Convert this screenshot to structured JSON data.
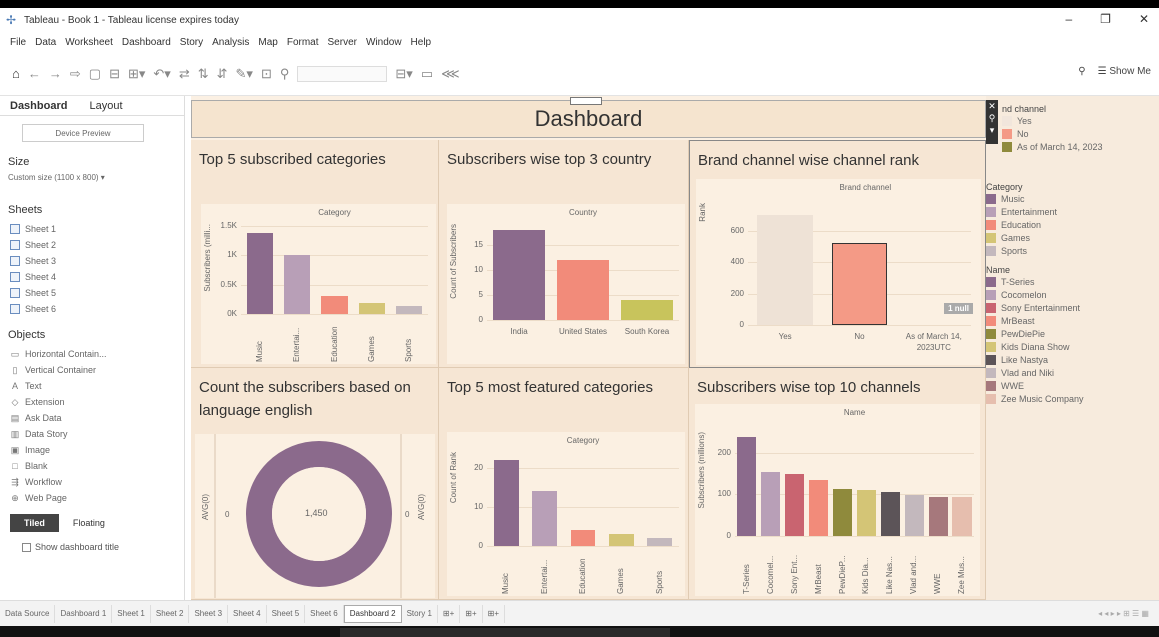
{
  "window": {
    "title": "Tableau - Book 1 - Tableau license expires today",
    "minimize": "–",
    "restore": "❐",
    "close": "✕"
  },
  "menu": [
    "File",
    "Data",
    "Worksheet",
    "Dashboard",
    "Story",
    "Analysis",
    "Map",
    "Format",
    "Server",
    "Window",
    "Help"
  ],
  "toolbar": {
    "show_me": "Show Me"
  },
  "left_pane": {
    "tabs": [
      "Dashboard",
      "Layout"
    ],
    "device_preview": "Device Preview",
    "size_heading": "Size",
    "size_value": "Custom size (1100 x 800) ▾",
    "sheets_heading": "Sheets",
    "sheets": [
      "Sheet 1",
      "Sheet 2",
      "Sheet 3",
      "Sheet 4",
      "Sheet 5",
      "Sheet 6"
    ],
    "objects_heading": "Objects",
    "objects": [
      {
        "icon": "▭",
        "label": "Horizontal Contain..."
      },
      {
        "icon": "▯",
        "label": "Vertical Container"
      },
      {
        "icon": "A",
        "label": "Text"
      },
      {
        "icon": "◇",
        "label": "Extension"
      },
      {
        "icon": "▤",
        "label": "Ask Data"
      },
      {
        "icon": "▥",
        "label": "Data Story"
      },
      {
        "icon": "▣",
        "label": "Image"
      },
      {
        "icon": "□",
        "label": "Blank"
      },
      {
        "icon": "⇶",
        "label": "Workflow"
      },
      {
        "icon": "⊕",
        "label": "Web Page"
      }
    ],
    "tiled": "Tiled",
    "floating": "Floating",
    "show_title": "Show dashboard title"
  },
  "dashboard": {
    "title": "Dashboard",
    "panels": {
      "p1": {
        "title": "Top  5  subscribed categories"
      },
      "p2": {
        "title": "Subscribers wise top 3 country"
      },
      "p3": {
        "title": "Brand channel wise channel rank"
      },
      "p4": {
        "title": "Count the subscribers based on language english"
      },
      "p5": {
        "title": "Top 5 most featured categories"
      },
      "p6": {
        "title": "Subscribers wise top 10 channels"
      }
    }
  },
  "chart_data": [
    {
      "type": "bar",
      "header": "Category",
      "ylabel": "Subscribers (milli...",
      "ylim": [
        0,
        1600
      ],
      "yticks": [
        "0K",
        "0.5K",
        "1K",
        "1.5K"
      ],
      "categories": [
        "Music",
        "Entertai...",
        "Education",
        "Games",
        "Sports"
      ],
      "values": [
        1380,
        1000,
        310,
        190,
        130
      ],
      "colors": [
        "#8b6a8c",
        "#b89fb7",
        "#f28b7a",
        "#d4c576",
        "#c3b8bd"
      ]
    },
    {
      "type": "bar",
      "header": "Country",
      "ylabel": "Count of Subscribers",
      "ylim": [
        0,
        20
      ],
      "yticks": [
        "0",
        "5",
        "10",
        "15"
      ],
      "categories": [
        "India",
        "United States",
        "South Korea"
      ],
      "values": [
        18,
        12,
        4
      ],
      "colors": [
        "#8b6a8c",
        "#f28b7a",
        "#c8c45c"
      ]
    },
    {
      "type": "bar",
      "header": "Brand channel",
      "ylabel": "Rank",
      "ylim": [
        0,
        800
      ],
      "yticks": [
        "0",
        "200",
        "400",
        "600"
      ],
      "categories": [
        "Yes",
        "No",
        "As of March 14, 2023UTC"
      ],
      "values": [
        700,
        520,
        0
      ],
      "colors": [
        "#eee2d6",
        "#f49a86",
        "#d8cdc2"
      ],
      "null_badge": "1 null"
    },
    {
      "type": "pie",
      "header": "",
      "center_label": "1,450",
      "values": [
        1450
      ],
      "colors": [
        "#8b6a8c"
      ],
      "side_labels": [
        "AVG(0)",
        "0",
        "0",
        "AVG(0)"
      ]
    },
    {
      "type": "bar",
      "header": "Category",
      "ylabel": "Count of Rank",
      "ylim": [
        0,
        25
      ],
      "yticks": [
        "0",
        "10",
        "20"
      ],
      "categories": [
        "Music",
        "Entertai...",
        "Education",
        "Games",
        "Sports"
      ],
      "values": [
        22,
        14,
        4,
        3,
        2
      ],
      "colors": [
        "#8b6a8c",
        "#b89fb7",
        "#f28b7a",
        "#d4c576",
        "#c3b8bd"
      ]
    },
    {
      "type": "bar",
      "header": "Name",
      "ylabel": "Subscribers (millions)",
      "ylim": [
        0,
        260
      ],
      "yticks": [
        "0",
        "100",
        "200"
      ],
      "categories": [
        "T-Series",
        "Cocomel...",
        "Sony Ent...",
        "MrBeast",
        "PewDieP...",
        "Kids Dia...",
        "Like Nas...",
        "Vlad and...",
        "WWE",
        "Zee Mus..."
      ],
      "values": [
        238,
        155,
        150,
        135,
        112,
        111,
        106,
        98,
        95,
        94
      ],
      "colors": [
        "#8b6a8c",
        "#b89fb7",
        "#c96470",
        "#f28b7a",
        "#8f8a3c",
        "#d4c576",
        "#5c5458",
        "#c3b8bd",
        "#a6787c",
        "#e6beae"
      ]
    }
  ],
  "legend": {
    "brand_heading": "nd channel",
    "brand": [
      {
        "label": "Yes",
        "color": "#f1e6dc"
      },
      {
        "label": "No",
        "color": "#f49a86"
      },
      {
        "label": "As of March 14, 2023",
        "color": "#8f8a3c"
      }
    ],
    "category_heading": "Category",
    "category": [
      {
        "label": "Music",
        "color": "#8b6a8c"
      },
      {
        "label": "Entertainment",
        "color": "#b89fb7"
      },
      {
        "label": "Education",
        "color": "#f28b7a"
      },
      {
        "label": "Games",
        "color": "#d4c576"
      },
      {
        "label": "Sports",
        "color": "#c3b8bd"
      }
    ],
    "name_heading": "Name",
    "name": [
      {
        "label": "T-Series",
        "color": "#8b6a8c"
      },
      {
        "label": "Cocomelon",
        "color": "#b89fb7"
      },
      {
        "label": "Sony Entertainment",
        "color": "#c96470"
      },
      {
        "label": "MrBeast",
        "color": "#f28b7a"
      },
      {
        "label": "PewDiePie",
        "color": "#8f8a3c"
      },
      {
        "label": "Kids Diana Show",
        "color": "#d4c576"
      },
      {
        "label": "Like Nastya",
        "color": "#5c5458"
      },
      {
        "label": "Vlad and Niki",
        "color": "#c3b8bd"
      },
      {
        "label": "WWE",
        "color": "#a6787c"
      },
      {
        "label": "Zee Music Company",
        "color": "#e6beae"
      }
    ]
  },
  "bottom_tabs": [
    "Data Source",
    "Dashboard 1",
    "Sheet 1",
    "Sheet 2",
    "Sheet 3",
    "Sheet 4",
    "Sheet 5",
    "Sheet 6",
    "Dashboard 2",
    "Story 1"
  ],
  "bottom_active": "Dashboard 2"
}
